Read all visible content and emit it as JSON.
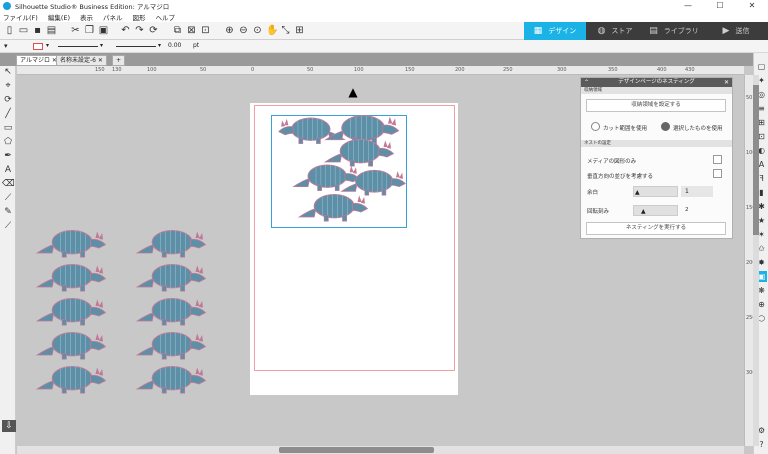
{
  "window": {
    "title": "Silhouette Studio® Business Edition: アルマジロ",
    "minimize": "—",
    "maximize": "☐",
    "close": "✕"
  },
  "menu": [
    "ファイル(F)",
    "編集(E)",
    "表示",
    "パネル",
    "図形",
    "ヘルプ"
  ],
  "nav_tabs": [
    {
      "label": "デザイン",
      "icon": "design-icon"
    },
    {
      "label": "ストア",
      "icon": "store-icon"
    },
    {
      "label": "ライブラリ",
      "icon": "library-icon"
    },
    {
      "label": "送信",
      "icon": "send-icon"
    }
  ],
  "line_settings": {
    "width_value": "0.00",
    "unit": "pt"
  },
  "doc_tabs": [
    "アルマジロ",
    "名称未設定-6",
    "+"
  ],
  "ruler_h": [
    "150",
    "130",
    "100",
    "50",
    "0",
    "50",
    "100",
    "150",
    "200",
    "250",
    "300",
    "350",
    "400",
    "430"
  ],
  "ruler_v": [
    "50",
    "100",
    "150",
    "200",
    "250",
    "300"
  ],
  "panel": {
    "title": "デザインページのネスティング",
    "section1": "収納領域",
    "set_area_button": "収納領域を設定する",
    "radio_cut_area": "カット範囲を使用",
    "radio_selected": "選択したものを使用",
    "section2": "ネストの設定",
    "media_shapes_only": "メディアの図形のみ",
    "vertical_order": "垂直方向の並びを考慮する",
    "margin_label": "余白",
    "margin_value": "1",
    "rotation_label": "回転刻み",
    "rotation_value": "2",
    "run_button": "ネスティングを実行する"
  },
  "colors": {
    "accent": "#1bb3e6",
    "armadillo_body": "#5d8fa6",
    "armadillo_outline": "#c07a98",
    "cut_line": "#f0a0a0"
  }
}
